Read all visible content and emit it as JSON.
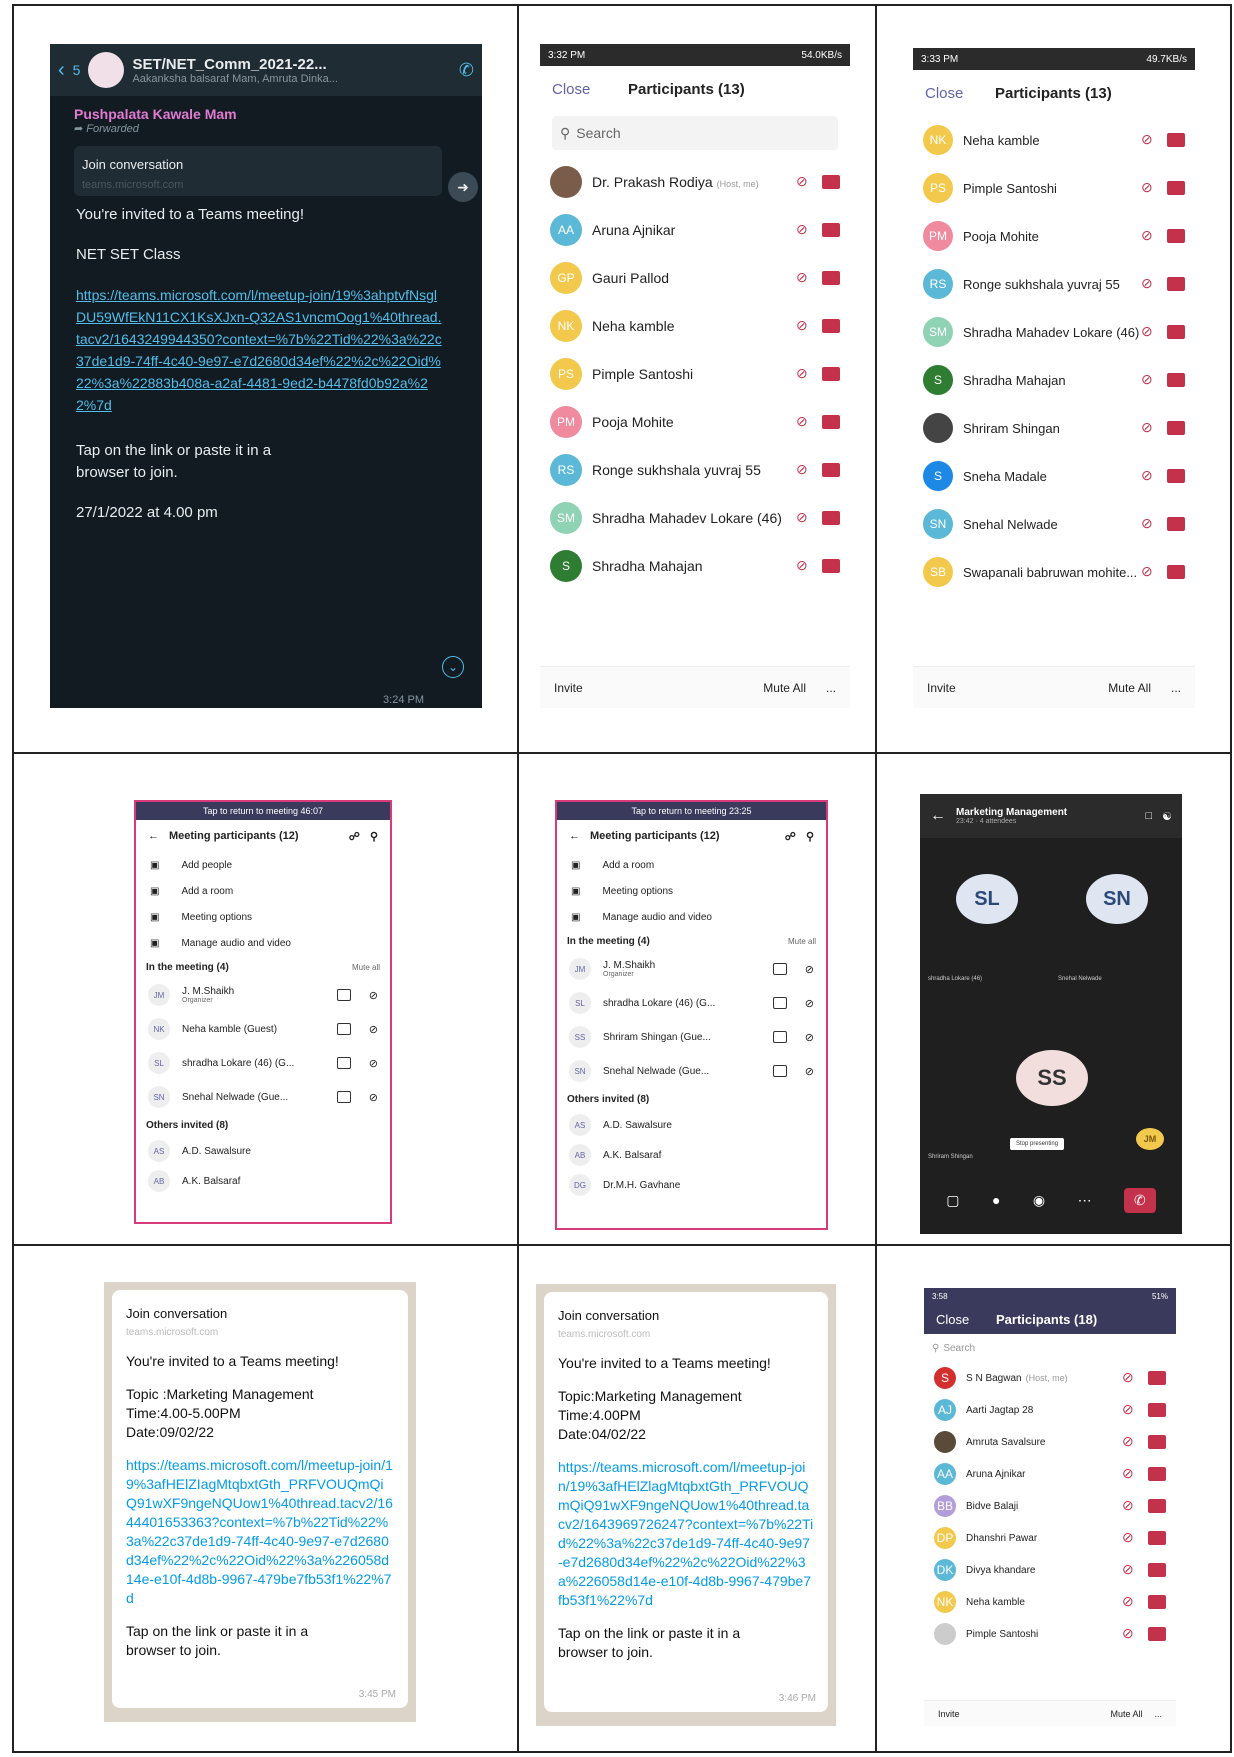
{
  "chat1": {
    "header": {
      "back_count": "5",
      "group_name": "SET/NET_Comm_2021-22...",
      "members": "Aakanksha balsaraf Mam, Amruta Dinka..."
    },
    "sender": "Pushpalata Kawale Mam",
    "forwarded": "Forwarded",
    "join_title": "Join conversation",
    "join_domain": "teams.microsoft.com",
    "invite": "You're invited to a Teams meeting!",
    "topic": "NET SET Class",
    "link": "https://teams.microsoft.com/l/meetup-join/19%3ahptvfNsglDU59WfEkN11CX1KsXJxn-Q32AS1vncmOog1%40thread.tacv2/1643249944350?context=%7b%22Tid%22%3a%22c37de1d9-74ff-4c40-9e97-e7d2680d34ef%22%2c%22Oid%22%3a%22883b408a-a2af-4481-9ed2-b4478fd0b92a%22%7d",
    "tap": "Tap on the link or paste it in a browser to join.",
    "date": "27/1/2022 at 4.00 pm",
    "time": "3:24 PM"
  },
  "panel2": {
    "status_time": "3:32 PM",
    "status_right": "54.0KB/s",
    "close": "Close",
    "title": "Participants (13)",
    "search": "Search",
    "participants": [
      {
        "init": "",
        "name": "Dr. Prakash Rodiya",
        "tag": "(Host, me)",
        "color": "#7a5c4a"
      },
      {
        "init": "AA",
        "name": "Aruna Ajnikar",
        "color": "#5bb8d6"
      },
      {
        "init": "GP",
        "name": "Gauri Pallod",
        "color": "#f2c94c"
      },
      {
        "init": "NK",
        "name": "Neha kamble",
        "color": "#f2c94c"
      },
      {
        "init": "PS",
        "name": "Pimple Santoshi",
        "color": "#f2c94c"
      },
      {
        "init": "PM",
        "name": "Pooja Mohite",
        "color": "#f08a9e"
      },
      {
        "init": "RS",
        "name": "Ronge sukhshala yuvraj 55",
        "color": "#5bb8d6"
      },
      {
        "init": "SM",
        "name": "Shradha Mahadev Lokare (46)",
        "color": "#8fd3b4"
      },
      {
        "init": "S",
        "name": "Shradha Mahajan",
        "color": "#2e7d32"
      }
    ],
    "invite": "Invite",
    "mute_all": "Mute All",
    "more": "..."
  },
  "panel3": {
    "status_time": "3:33 PM",
    "status_right": "49.7KB/s",
    "close": "Close",
    "title": "Participants (13)",
    "participants": [
      {
        "init": "NK",
        "name": "Neha kamble",
        "color": "#f2c94c"
      },
      {
        "init": "PS",
        "name": "Pimple Santoshi",
        "color": "#f2c94c"
      },
      {
        "init": "PM",
        "name": "Pooja Mohite",
        "color": "#f08a9e"
      },
      {
        "init": "RS",
        "name": "Ronge sukhshala yuvraj 55",
        "color": "#5bb8d6"
      },
      {
        "init": "SM",
        "name": "Shradha Mahadev Lokare (46)",
        "color": "#8fd3b4"
      },
      {
        "init": "S",
        "name": "Shradha Mahajan",
        "color": "#2e7d32"
      },
      {
        "init": "",
        "name": "Shriram Shingan",
        "color": "#444444"
      },
      {
        "init": "S",
        "name": "Sneha Madale",
        "color": "#1e88e5"
      },
      {
        "init": "SN",
        "name": "Snehal Nelwade",
        "color": "#5bb8d6"
      },
      {
        "init": "SB",
        "name": "Swapanali babruwan mohite...",
        "color": "#f2c94c"
      }
    ],
    "invite": "Invite",
    "mute_all": "Mute All",
    "more": "..."
  },
  "panel4": {
    "banner": "Tap to return to meeting 46:07",
    "title": "Meeting participants (12)",
    "options": [
      "Add people",
      "Add a room",
      "Meeting options",
      "Manage audio and video"
    ],
    "in_meeting": "In the meeting (4)",
    "mute_all": "Mute all",
    "rows": [
      {
        "init": "JM",
        "name": "J. M.Shaikh",
        "sub": "Organizer"
      },
      {
        "init": "NK",
        "name": "Neha kamble (Guest)"
      },
      {
        "init": "SL",
        "name": "shradha Lokare (46) (G..."
      },
      {
        "init": "SN",
        "name": "Snehal Nelwade (Gue..."
      }
    ],
    "others": "Others invited (8)",
    "invited": [
      {
        "init": "AS",
        "name": "A.D. Sawalsure"
      },
      {
        "init": "AB",
        "name": "A.K. Balsaraf"
      }
    ]
  },
  "panel5": {
    "banner": "Tap to return to meeting 23:25",
    "title": "Meeting participants (12)",
    "options": [
      "Add a room",
      "Meeting options",
      "Manage audio and video"
    ],
    "in_meeting": "In the meeting (4)",
    "mute_all": "Mute all",
    "rows": [
      {
        "init": "JM",
        "name": "J. M.Shaikh",
        "sub": "Organizer"
      },
      {
        "init": "SL",
        "name": "shradha Lokare (46) (G..."
      },
      {
        "init": "SS",
        "name": "Shriram Shingan (Gue..."
      },
      {
        "init": "SN",
        "name": "Snehal Nelwade (Gue..."
      }
    ],
    "others": "Others invited (8)",
    "invited": [
      {
        "init": "AS",
        "name": "A.D. Sawalsure"
      },
      {
        "init": "AB",
        "name": "A.K. Balsaraf"
      },
      {
        "init": "DG",
        "name": "Dr.M.H. Gavhane"
      }
    ]
  },
  "call": {
    "title": "Marketing Management",
    "sub": "23:42 · 4 attendees",
    "tiles": [
      {
        "init": "SL",
        "label": "shradha Lokare (46)"
      },
      {
        "init": "SN",
        "label": "Snehal Nelwade"
      },
      {
        "init": "SS",
        "label": "Shriram Shingan"
      }
    ],
    "jm": "JM",
    "stop": "Stop presenting"
  },
  "invite7": {
    "join_title": "Join conversation",
    "domain": "teams.microsoft.com",
    "invite": "You're invited to a Teams meeting!",
    "topic": "Topic :Marketing Management",
    "time": "Time:4.00-5.00PM",
    "date": "Date:09/02/22",
    "link": "https://teams.microsoft.com/l/meetup-join/19%3afHElZIagMtqbxtGth_PRFVOUQmQiQ91wXF9ngeNQUow1%40thread.tacv2/1644401653363?context=%7b%22Tid%22%3a%22c37de1d9-74ff-4c40-9e97-e7d2680d34ef%22%2c%22Oid%22%3a%226058d14e-e10f-4d8b-9967-479be7fb53f1%22%7d",
    "tap": "Tap on the link or paste it in a browser to join.",
    "stamp": "3:45 PM"
  },
  "invite8": {
    "join_title": "Join conversation",
    "domain": "teams.microsoft.com",
    "invite": "You're invited to a Teams meeting!",
    "topic": "Topic:Marketing Management",
    "time": "Time:4.00PM",
    "date": "Date:04/02/22",
    "link": "https://teams.microsoft.com/l/meetup-join/19%3afHElZlagMtqbxtGth_PRFVOUQmQiQ91wXF9ngeNQUow1%40thread.tacv2/1643969726247?context=%7b%22Tid%22%3a%22c37de1d9-74ff-4c40-9e97-e7d2680d34ef%22%2c%22Oid%22%3a%226058d14e-e10f-4d8b-9967-479be7fb53f1%22%7d",
    "tap": "Tap on the link or paste it in a browser to join.",
    "stamp": "3:46 PM"
  },
  "panel9": {
    "status_time": "3:58",
    "status_right": "51%",
    "close": "Close",
    "title": "Participants (18)",
    "search": "Search",
    "participants": [
      {
        "init": "S",
        "name": "S N Bagwan",
        "tag": "(Host, me)",
        "color": "#d32f2f"
      },
      {
        "init": "AJ",
        "name": "Aarti Jagtap 28",
        "color": "#5bb8d6"
      },
      {
        "init": "",
        "name": "Amruta Savalsure",
        "color": "#5a4a3a"
      },
      {
        "init": "AA",
        "name": "Aruna Ajnikar",
        "color": "#5bb8d6"
      },
      {
        "init": "BB",
        "name": "Bidve Balaji",
        "color": "#b39ddb"
      },
      {
        "init": "DP",
        "name": "Dhanshri Pawar",
        "color": "#f2c94c"
      },
      {
        "init": "DK",
        "name": "Divya khandare",
        "color": "#5bb8d6"
      },
      {
        "init": "NK",
        "name": "Neha kamble",
        "color": "#f2c94c"
      },
      {
        "init": "",
        "name": "Pimple Santoshi",
        "color": "#cccccc"
      }
    ],
    "invite": "Invite",
    "mute_all": "Mute All",
    "more": "..."
  }
}
